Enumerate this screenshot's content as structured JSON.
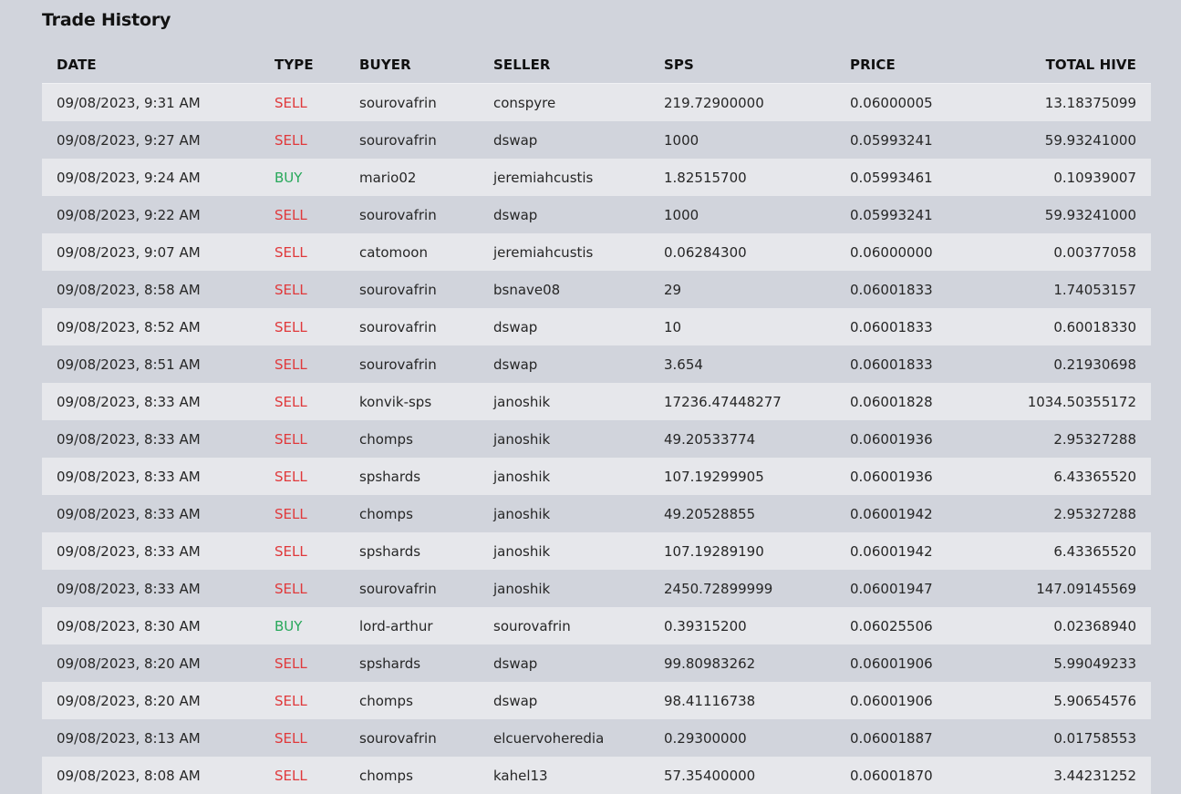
{
  "title": "Trade History",
  "colors": {
    "sell": "#e0393b",
    "buy": "#27a85a"
  },
  "columns": [
    "DATE",
    "TYPE",
    "BUYER",
    "SELLER",
    "SPS",
    "PRICE",
    "TOTAL HIVE"
  ],
  "rows": [
    {
      "date": "09/08/2023, 9:31 AM",
      "type": "SELL",
      "buyer": "sourovafrin",
      "seller": "conspyre",
      "sps": "219.72900000",
      "price": "0.06000005",
      "total": "13.18375099"
    },
    {
      "date": "09/08/2023, 9:27 AM",
      "type": "SELL",
      "buyer": "sourovafrin",
      "seller": "dswap",
      "sps": "1000",
      "price": "0.05993241",
      "total": "59.93241000"
    },
    {
      "date": "09/08/2023, 9:24 AM",
      "type": "BUY",
      "buyer": "mario02",
      "seller": "jeremiahcustis",
      "sps": "1.82515700",
      "price": "0.05993461",
      "total": "0.10939007"
    },
    {
      "date": "09/08/2023, 9:22 AM",
      "type": "SELL",
      "buyer": "sourovafrin",
      "seller": "dswap",
      "sps": "1000",
      "price": "0.05993241",
      "total": "59.93241000"
    },
    {
      "date": "09/08/2023, 9:07 AM",
      "type": "SELL",
      "buyer": "catomoon",
      "seller": "jeremiahcustis",
      "sps": "0.06284300",
      "price": "0.06000000",
      "total": "0.00377058"
    },
    {
      "date": "09/08/2023, 8:58 AM",
      "type": "SELL",
      "buyer": "sourovafrin",
      "seller": "bsnave08",
      "sps": "29",
      "price": "0.06001833",
      "total": "1.74053157"
    },
    {
      "date": "09/08/2023, 8:52 AM",
      "type": "SELL",
      "buyer": "sourovafrin",
      "seller": "dswap",
      "sps": "10",
      "price": "0.06001833",
      "total": "0.60018330"
    },
    {
      "date": "09/08/2023, 8:51 AM",
      "type": "SELL",
      "buyer": "sourovafrin",
      "seller": "dswap",
      "sps": "3.654",
      "price": "0.06001833",
      "total": "0.21930698"
    },
    {
      "date": "09/08/2023, 8:33 AM",
      "type": "SELL",
      "buyer": "konvik-sps",
      "seller": "janoshik",
      "sps": "17236.47448277",
      "price": "0.06001828",
      "total": "1034.50355172"
    },
    {
      "date": "09/08/2023, 8:33 AM",
      "type": "SELL",
      "buyer": "chomps",
      "seller": "janoshik",
      "sps": "49.20533774",
      "price": "0.06001936",
      "total": "2.95327288"
    },
    {
      "date": "09/08/2023, 8:33 AM",
      "type": "SELL",
      "buyer": "spshards",
      "seller": "janoshik",
      "sps": "107.19299905",
      "price": "0.06001936",
      "total": "6.43365520"
    },
    {
      "date": "09/08/2023, 8:33 AM",
      "type": "SELL",
      "buyer": "chomps",
      "seller": "janoshik",
      "sps": "49.20528855",
      "price": "0.06001942",
      "total": "2.95327288"
    },
    {
      "date": "09/08/2023, 8:33 AM",
      "type": "SELL",
      "buyer": "spshards",
      "seller": "janoshik",
      "sps": "107.19289190",
      "price": "0.06001942",
      "total": "6.43365520"
    },
    {
      "date": "09/08/2023, 8:33 AM",
      "type": "SELL",
      "buyer": "sourovafrin",
      "seller": "janoshik",
      "sps": "2450.72899999",
      "price": "0.06001947",
      "total": "147.09145569"
    },
    {
      "date": "09/08/2023, 8:30 AM",
      "type": "BUY",
      "buyer": "lord-arthur",
      "seller": "sourovafrin",
      "sps": "0.39315200",
      "price": "0.06025506",
      "total": "0.02368940"
    },
    {
      "date": "09/08/2023, 8:20 AM",
      "type": "SELL",
      "buyer": "spshards",
      "seller": "dswap",
      "sps": "99.80983262",
      "price": "0.06001906",
      "total": "5.99049233"
    },
    {
      "date": "09/08/2023, 8:20 AM",
      "type": "SELL",
      "buyer": "chomps",
      "seller": "dswap",
      "sps": "98.41116738",
      "price": "0.06001906",
      "total": "5.90654576"
    },
    {
      "date": "09/08/2023, 8:13 AM",
      "type": "SELL",
      "buyer": "sourovafrin",
      "seller": "elcuervoheredia",
      "sps": "0.29300000",
      "price": "0.06001887",
      "total": "0.01758553"
    },
    {
      "date": "09/08/2023, 8:08 AM",
      "type": "SELL",
      "buyer": "chomps",
      "seller": "kahel13",
      "sps": "57.35400000",
      "price": "0.06001870",
      "total": "3.44231252"
    }
  ]
}
